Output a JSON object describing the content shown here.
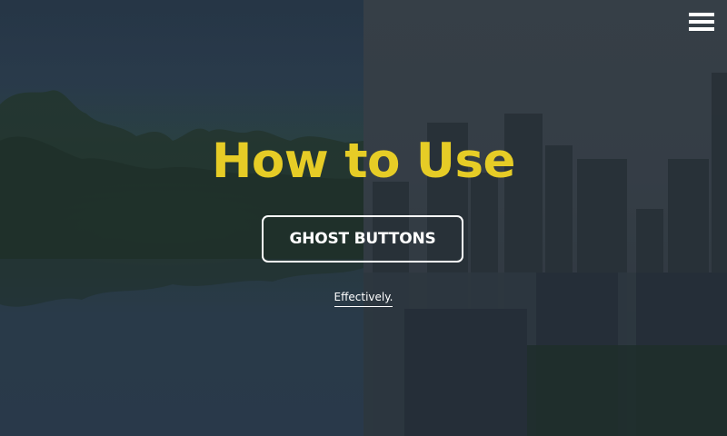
{
  "hero": {
    "title": "How to Use",
    "button_label": "GHOST BUTTONS",
    "link_text": "Effectively."
  },
  "nav": {
    "menu_icon": "hamburger-menu-icon"
  },
  "colors": {
    "title": "#e6cc26",
    "button_border": "#ffffff",
    "text": "#ffffff"
  }
}
